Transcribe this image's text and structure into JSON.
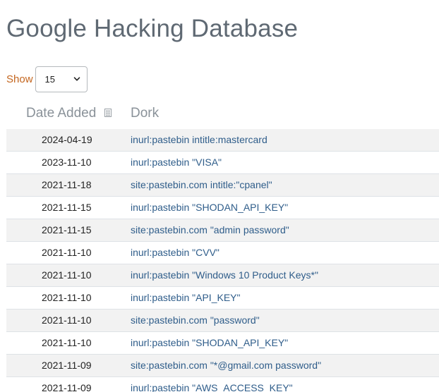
{
  "page": {
    "title": "Google Hacking Database"
  },
  "length_control": {
    "label": "Show",
    "selected": "15",
    "icon": "chevron-down-icon"
  },
  "table": {
    "columns": [
      "Date Added",
      "Dork"
    ],
    "sort_icon": "sort-icon",
    "rows": [
      {
        "date": "2024-04-19",
        "dork": "inurl:pastebin intitle:mastercard"
      },
      {
        "date": "2023-11-10",
        "dork": "inurl:pastebin \"VISA\""
      },
      {
        "date": "2021-11-18",
        "dork": "site:pastebin.com intitle:\"cpanel\""
      },
      {
        "date": "2021-11-15",
        "dork": "inurl:pastebin \"SHODAN_API_KEY\""
      },
      {
        "date": "2021-11-15",
        "dork": "site:pastebin.com \"admin password\""
      },
      {
        "date": "2021-11-10",
        "dork": "inurl:pastebin \"CVV\""
      },
      {
        "date": "2021-11-10",
        "dork": "inurl:pastebin \"Windows 10 Product Keys*\""
      },
      {
        "date": "2021-11-10",
        "dork": "inurl:pastebin \"API_KEY\""
      },
      {
        "date": "2021-11-10",
        "dork": "site:pastebin.com \"password\""
      },
      {
        "date": "2021-11-10",
        "dork": "inurl:pastebin \"SHODAN_API_KEY\""
      },
      {
        "date": "2021-11-09",
        "dork": "site:pastebin.com \"*@gmail.com password\""
      },
      {
        "date": "2021-11-09",
        "dork": "inurl:pastebin \"AWS_ACCESS_KEY\""
      }
    ]
  },
  "colors": {
    "title": "#5f6973",
    "show_label": "#c4661f",
    "link": "#2f5d8a",
    "striped_row": "#f2f2f2"
  }
}
